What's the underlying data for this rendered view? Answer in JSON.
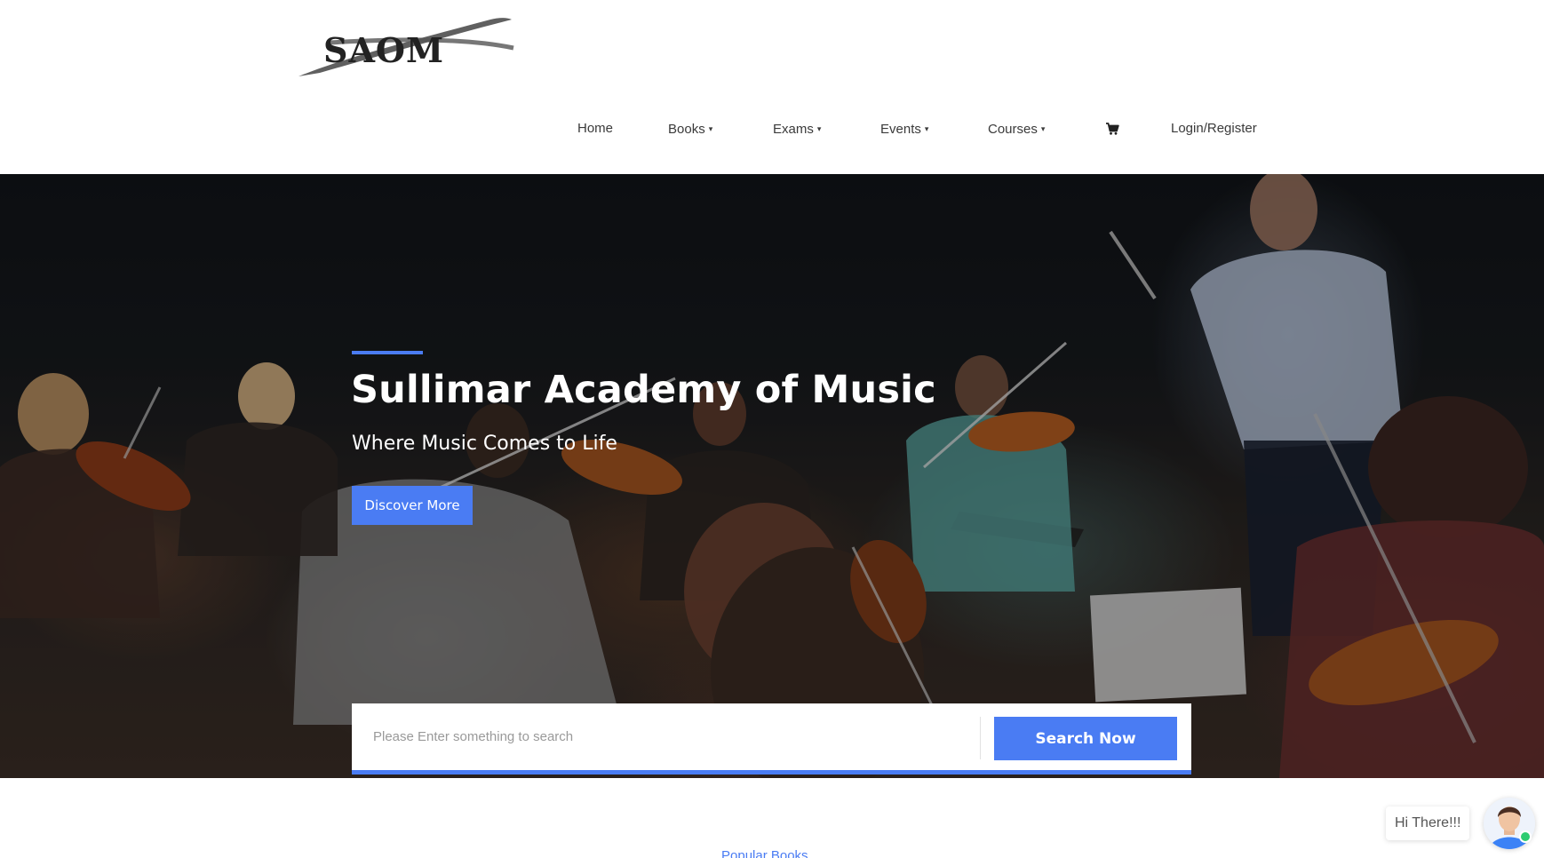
{
  "brand": {
    "logo_text": "SAOM"
  },
  "nav": {
    "items": [
      {
        "label": "Home",
        "has_dropdown": false
      },
      {
        "label": "Books",
        "has_dropdown": true
      },
      {
        "label": "Exams",
        "has_dropdown": true
      },
      {
        "label": "Events",
        "has_dropdown": true
      },
      {
        "label": "Courses",
        "has_dropdown": true
      }
    ],
    "caret": "▾",
    "cart_icon": "shopping-cart-icon",
    "login_label": "Login/Register"
  },
  "hero": {
    "title": "Sullimar Academy of Music",
    "subtitle": "Where Music Comes to Life",
    "cta_label": "Discover More",
    "background_description_icon": "orchestra-photo"
  },
  "search": {
    "placeholder": "Please Enter something to search",
    "value": "",
    "button_label": "Search Now"
  },
  "section": {
    "label": "Popular Books"
  },
  "chat": {
    "greeting": "Hi There!!!",
    "status": "online"
  },
  "colors": {
    "accent": "#4a7cf3",
    "nav_text": "#3a3a3a",
    "hero_text": "#ffffff",
    "online": "#2ecc71"
  }
}
